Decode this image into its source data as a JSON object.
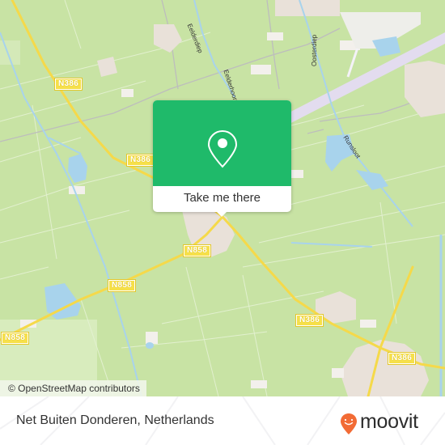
{
  "map": {
    "road_labels": [
      {
        "id": "n386-top-left",
        "text": "N386"
      },
      {
        "id": "n386-upper",
        "text": "N386"
      },
      {
        "id": "n386-mid",
        "text": "N386"
      },
      {
        "id": "n858-center",
        "text": "N858"
      },
      {
        "id": "n858-left",
        "text": "N858"
      },
      {
        "id": "n858-far-left",
        "text": "N858"
      },
      {
        "id": "n386-lower-right",
        "text": "N386"
      },
      {
        "id": "n386-bottom-right",
        "text": "N386"
      }
    ],
    "water_labels": [
      {
        "id": "eelderdiep",
        "text": "Eelderdiep"
      },
      {
        "id": "eelderhoorn",
        "text": "Eelderhoorn"
      },
      {
        "id": "oosterdiep",
        "text": "Oosterdiep"
      },
      {
        "id": "runsloot",
        "text": "Runsloot"
      }
    ],
    "attribution": "© OpenStreetMap contributors",
    "colors": {
      "land": "#c8e3a4",
      "water": "#a8d3ec",
      "road": "#f5d94a",
      "urban": "#e8e0d8",
      "runway": "#e3dcef"
    }
  },
  "popup": {
    "icon": "map-pin-icon",
    "button_label": "Take me there",
    "accent": "#1fba6a"
  },
  "footer": {
    "place_name": "Net Buiten Donderen, Netherlands",
    "logo_text": "moovit",
    "logo_accent": "#f26b35"
  }
}
